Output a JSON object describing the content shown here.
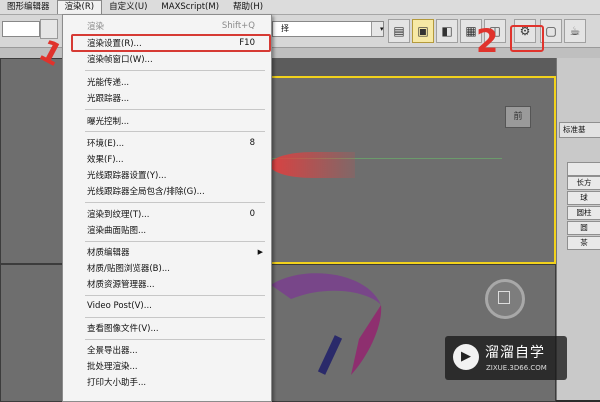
{
  "menubar": {
    "items": [
      "图形编辑器",
      "渲染(R)",
      "自定义(U)",
      "MAXScript(M)",
      "帮助(H)"
    ]
  },
  "toolbar": {
    "selection_combo": "择",
    "selection_combo_arrow": "▾",
    "icons": [
      "render-setup-icon",
      "rendered-frame-window-icon",
      "render-production-icon",
      "teapot-icon"
    ]
  },
  "render_menu": {
    "items": [
      {
        "label": "渲染",
        "shortcut": "Shift+Q",
        "disabled": true
      },
      {
        "label": "渲染设置(R)...",
        "shortcut": "F10",
        "highlighted": true
      },
      {
        "label": "渲染帧窗口(W)...",
        "shortcut": ""
      },
      {
        "label": "光能传递...",
        "shortcut": ""
      },
      {
        "label": "光跟踪器...",
        "shortcut": ""
      },
      {
        "label": "曝光控制...",
        "shortcut": ""
      },
      {
        "label": "环境(E)...",
        "shortcut": "8"
      },
      {
        "label": "效果(F)...",
        "shortcut": ""
      },
      {
        "label": "光线跟踪器设置(Y)...",
        "shortcut": ""
      },
      {
        "label": "光线跟踪器全局包含/排除(G)...",
        "shortcut": ""
      },
      {
        "label": "渲染到纹理(T)...",
        "shortcut": "0"
      },
      {
        "label": "渲染曲面贴图...",
        "shortcut": ""
      },
      {
        "label": "材质编辑器",
        "shortcut": "",
        "submenu": true
      },
      {
        "label": "材质/贴图浏览器(B)...",
        "shortcut": ""
      },
      {
        "label": "材质资源管理器...",
        "shortcut": ""
      },
      {
        "label": "Video Post(V)...",
        "shortcut": ""
      },
      {
        "label": "查看图像文件(V)...",
        "shortcut": ""
      },
      {
        "label": "全景导出器...",
        "shortcut": ""
      },
      {
        "label": "批处理渲染...",
        "shortcut": ""
      },
      {
        "label": "打印大小助手...",
        "shortcut": ""
      }
    ]
  },
  "viewport": {
    "viewcube_label": "前"
  },
  "command_panel": {
    "dropdown": "标准基",
    "rows": [
      "",
      "长方",
      "球",
      "圆柱",
      "圆",
      "茶"
    ]
  },
  "annotations": {
    "step1": "1",
    "step2": "2",
    "color": "#e0332c"
  },
  "watermark": {
    "title": "溜溜自学",
    "subtitle": "ZIXUE.3D66.COM"
  }
}
